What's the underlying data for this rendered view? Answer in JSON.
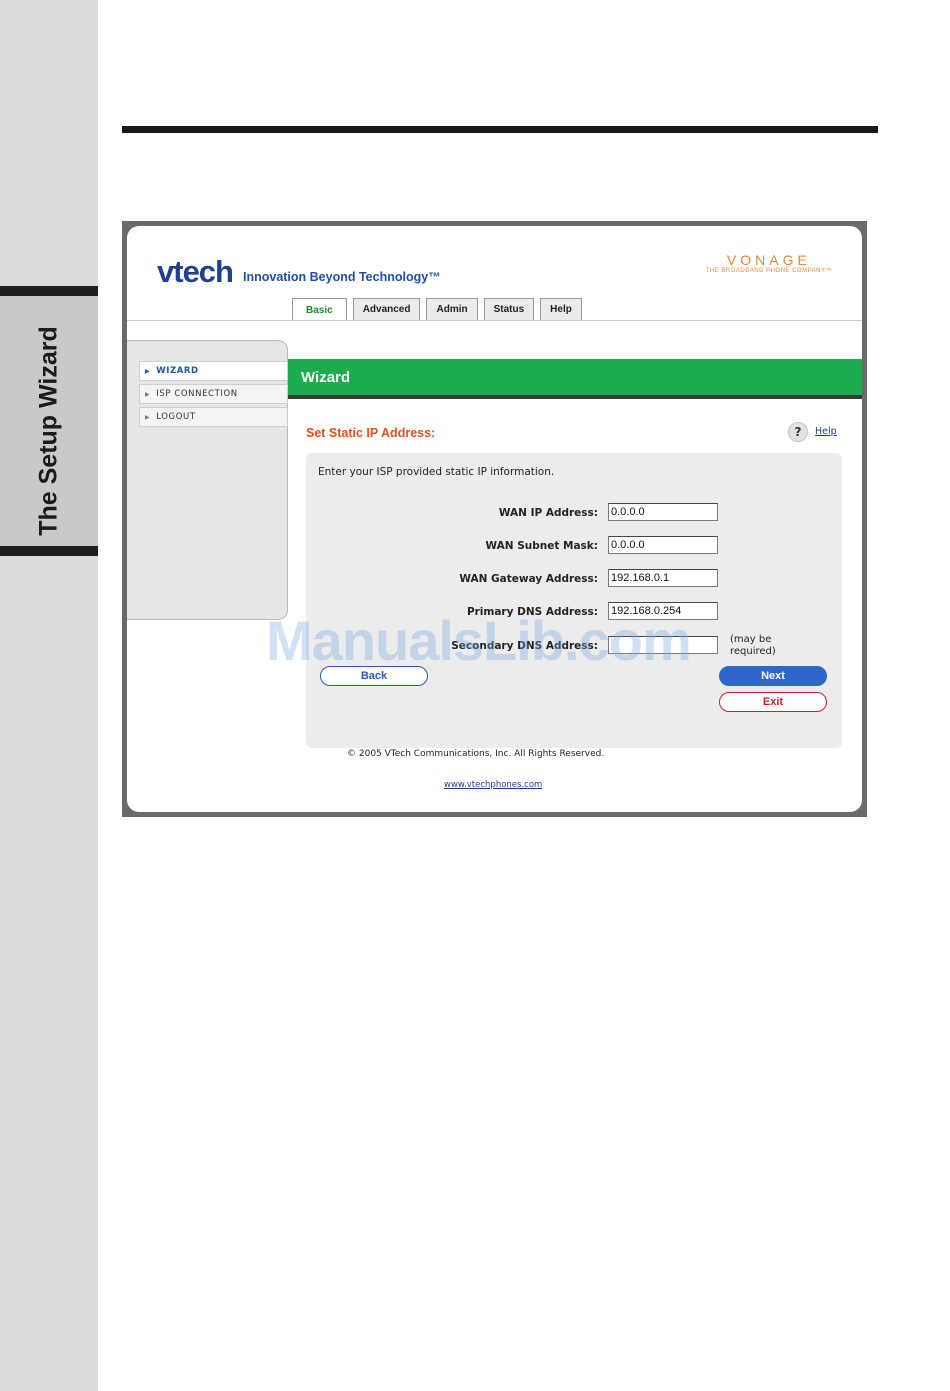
{
  "side_tab": {
    "title": "The Setup Wizard"
  },
  "app": {
    "logo": "vtech",
    "tagline": "Innovation Beyond Technology™",
    "partner": {
      "name": "VONAGE",
      "subtitle": "THE BROADBAND PHONE COMPANY™"
    }
  },
  "tabs": [
    {
      "label": "Basic",
      "active": true
    },
    {
      "label": "Advanced",
      "active": false
    },
    {
      "label": "Admin",
      "active": false
    },
    {
      "label": "Status",
      "active": false
    },
    {
      "label": "Help",
      "active": false
    }
  ],
  "sidebar": {
    "items": [
      {
        "label": "WIZARD",
        "active": true
      },
      {
        "label": "ISP CONNECTION",
        "active": false
      },
      {
        "label": "LOGOUT",
        "active": false
      }
    ]
  },
  "banner": {
    "title": "Wizard"
  },
  "section": {
    "title": "Set Static IP Address:",
    "help_label": "Help",
    "help_icon": "?"
  },
  "form": {
    "intro": "Enter your ISP provided static IP information.",
    "fields": [
      {
        "label": "WAN IP Address:",
        "value": "0.0.0.0"
      },
      {
        "label": "WAN Subnet Mask:",
        "value": "0.0.0.0"
      },
      {
        "label": "WAN Gateway Address:",
        "value": "192.168.0.1"
      },
      {
        "label": "Primary DNS Address:",
        "value": "192.168.0.254"
      },
      {
        "label": "Secondary DNS Address:",
        "value": "",
        "note_line1": "(may be",
        "note_line2": "required)"
      }
    ],
    "buttons": {
      "back": "Back",
      "next": "Next",
      "exit": "Exit"
    }
  },
  "footer": {
    "copyright": "© 2005 VTech Communications, Inc. All Rights Reserved.",
    "link": "www.vtechphones.com"
  },
  "watermark": "ManualsLib.com",
  "colors": {
    "brand_blue": "#1f3f8f",
    "banner_green": "#1bad4d",
    "section_orange": "#e0521c",
    "vonage_orange": "#e0893a"
  }
}
